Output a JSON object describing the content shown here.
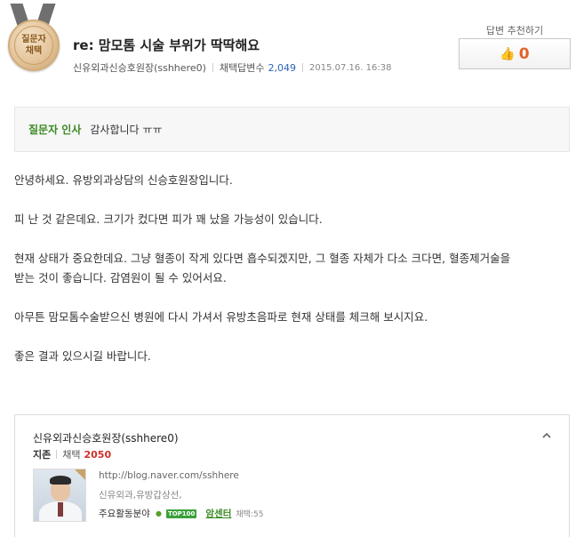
{
  "medal": {
    "line1": "질문자",
    "line2": "채택"
  },
  "question": {
    "title": "re: 맘모톰 시술 부위가 딱딱해요",
    "author": "신유외과신승호원장(sshhere0)",
    "adopt_label": "채택답변수",
    "adopt_count": "2,049",
    "date": "2015.07.16. 16:38"
  },
  "recommend": {
    "label": "답변 추천하기",
    "count": "0",
    "icon": "thumbs-up-icon"
  },
  "greeting": {
    "label": "질문자 인사",
    "text": "감사합니다 ㅠㅠ"
  },
  "answer": {
    "paragraphs": [
      "안녕하세요. 유방외과상담의 신승호원장입니다.",
      "피 난 것 같은데요. 크기가 컸다면 피가 꽤 났을 가능성이 있습니다.",
      "현재 상태가 중요한데요. 그냥 혈종이 작게 있다면 흡수되겠지만, 그 혈종 자체가 다소 크다면, 혈종제거술을",
      "받는 것이 좋습니다. 감염원이 될 수 있어서요.",
      "아무튼 맘모톰수술받으신 병원에 다시 가셔서 유방초음파로 현재 상태를 체크해 보시지요.",
      "좋은 결과 있으시길 바랍니다."
    ]
  },
  "profile": {
    "name": "신유외과신승호원장(sshhere0)",
    "grade": "지존",
    "adopt_label": "채택",
    "adopt_count": "2050",
    "blog_url": "http://blog.naver.com/sshhere",
    "specialty": "신유외과,유방갑상선,",
    "area_label": "주요활동분야",
    "badge": "TOP100",
    "field": "암센터",
    "field_count": "채택:55",
    "collapse_icon": "chevron-up-icon"
  },
  "colors": {
    "green": "#3b8a23",
    "orange": "#e3632b",
    "red": "#d0302b",
    "blue": "#2e63b8"
  }
}
